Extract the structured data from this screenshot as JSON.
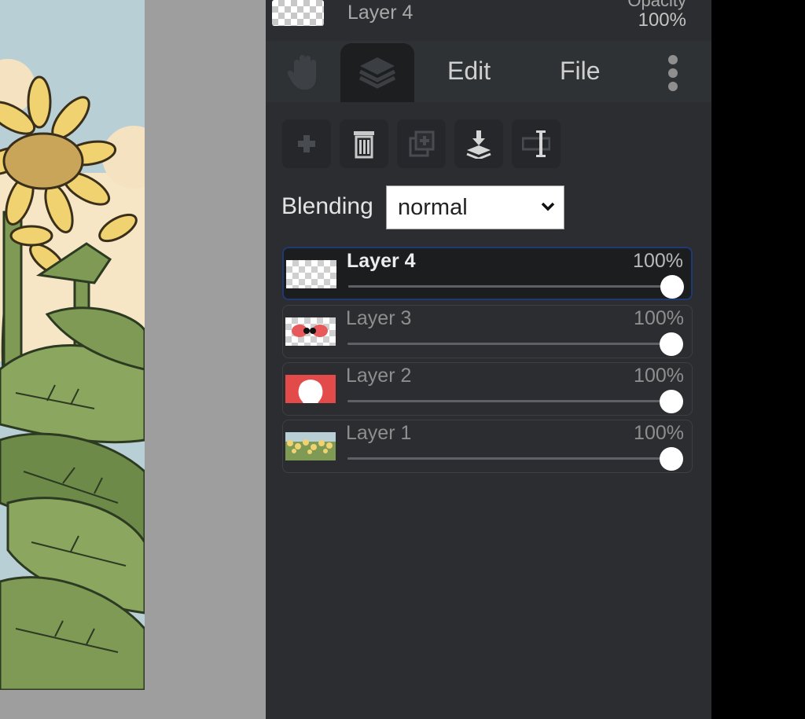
{
  "top_layer": {
    "name": "Layer 4",
    "opacity_label": "Opacity",
    "opacity_value": "100%"
  },
  "tabs": {
    "edit": "Edit",
    "file": "File"
  },
  "toolbar": {
    "icons": [
      "add-layer-icon",
      "delete-layer-icon",
      "duplicate-layer-icon",
      "merge-down-icon",
      "rename-layer-icon"
    ]
  },
  "blending": {
    "label": "Blending",
    "value": "normal"
  },
  "layers": [
    {
      "name": "Layer 4",
      "opacity": "100%",
      "opacity_value": 1.0,
      "active": true
    },
    {
      "name": "Layer 3",
      "opacity": "100%",
      "opacity_value": 1.0,
      "active": false
    },
    {
      "name": "Layer 2",
      "opacity": "100%",
      "opacity_value": 1.0,
      "active": false
    },
    {
      "name": "Layer 1",
      "opacity": "100%",
      "opacity_value": 1.0,
      "active": false
    }
  ],
  "colors": {
    "panel": "#2b2d30",
    "active_border": "#1f3a72",
    "canvas_bg": "#9e9e9e"
  }
}
